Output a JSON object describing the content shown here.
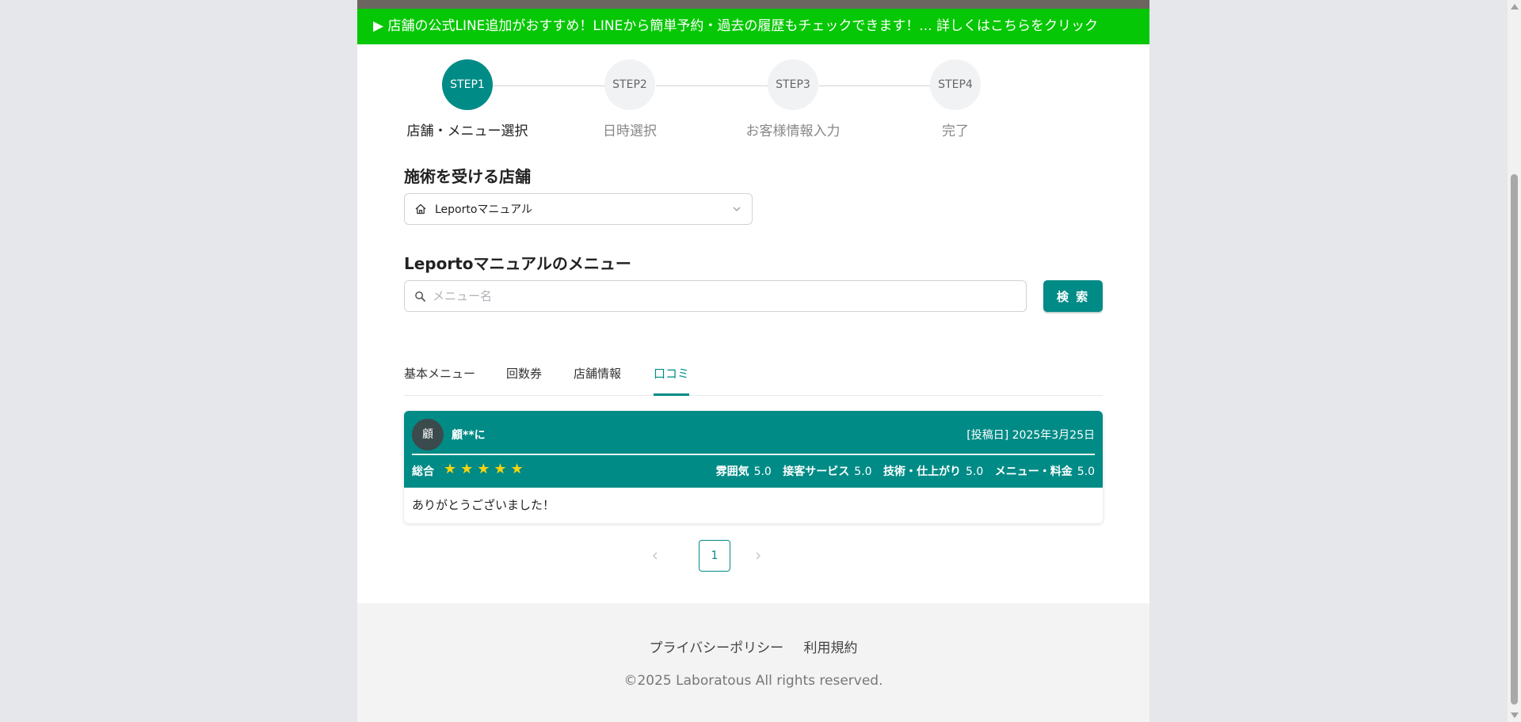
{
  "banner": {
    "text": "▶ 店舗の公式LINE追加がおすすめ！LINEから簡単予約・過去の履歴もチェックできます！... 詳しくはこちらをクリック",
    "color": "#06c705"
  },
  "steps": [
    {
      "num": "STEP1",
      "label": "店舗・メニュー選択",
      "active": true
    },
    {
      "num": "STEP2",
      "label": "日時選択",
      "active": false
    },
    {
      "num": "STEP3",
      "label": "お客様情報入力",
      "active": false
    },
    {
      "num": "STEP4",
      "label": "完了",
      "active": false
    }
  ],
  "store_section": {
    "title": "施術を受ける店舗",
    "selected_store": "Leportoマニュアル"
  },
  "menu_section": {
    "title": "Leportoマニュアルのメニュー",
    "search_placeholder": "メニュー名",
    "search_value": "",
    "search_button": "検 索"
  },
  "tabs": [
    {
      "label": "基本メニュー",
      "active": false
    },
    {
      "label": "回数券",
      "active": false
    },
    {
      "label": "店舗情報",
      "active": false
    },
    {
      "label": "口コミ",
      "active": true
    }
  ],
  "review": {
    "avatar_char": "顧",
    "reviewer": "顧**に",
    "post_date": "[投稿日] 2025年3月25日",
    "overall_label": "総合",
    "stars": "★★★★★",
    "star_rating": 5,
    "ratings": [
      {
        "label": "雰囲気",
        "value": "5.0"
      },
      {
        "label": "接客サービス",
        "value": "5.0"
      },
      {
        "label": "技術・仕上がり",
        "value": "5.0"
      },
      {
        "label": "メニュー・料金",
        "value": "5.0"
      }
    ],
    "body": "ありがとうございました！"
  },
  "pagination": {
    "current": "1"
  },
  "footer": {
    "privacy": "プライバシーポリシー",
    "terms": "利用規約",
    "copyright": "©2025 Laboratous All rights reserved."
  },
  "colors": {
    "accent": "#008b86",
    "star": "#f5d40f",
    "line_green": "#06c705"
  },
  "icons": {
    "store": "home-icon",
    "dropdown": "chevron-down-icon",
    "search": "search-icon",
    "prev": "chevron-left-icon",
    "next": "chevron-right-icon"
  }
}
